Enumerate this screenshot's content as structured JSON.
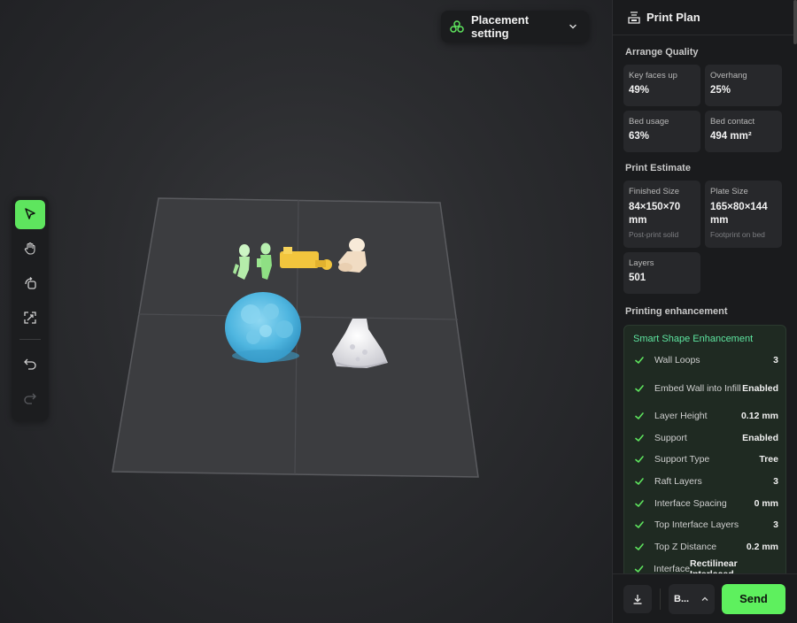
{
  "viewport": {
    "placement": {
      "label": "Placement setting",
      "icon": "placement-icon"
    },
    "toolbar": [
      {
        "name": "select-tool",
        "icon": "cursor-arrow-icon",
        "active": true
      },
      {
        "name": "pan-tool",
        "icon": "hand-icon",
        "active": false
      },
      {
        "name": "rotate-tool",
        "icon": "rotate-icon",
        "active": false
      },
      {
        "name": "scale-tool",
        "icon": "scale-arrows-icon",
        "active": false
      },
      {
        "name": "undo-button",
        "icon": "undo-icon",
        "active": false
      },
      {
        "name": "redo-button",
        "icon": "redo-icon",
        "active": false
      }
    ],
    "models": [
      "green-figure-1",
      "green-figure-2",
      "yellow-part",
      "beige-figure",
      "blue-round-model",
      "white-dress-model"
    ]
  },
  "panel": {
    "title": "Print Plan",
    "title_icon": "print-plan-icon",
    "arrange_quality": {
      "title": "Arrange Quality",
      "stats": [
        {
          "key": "Key faces up",
          "value": "49%"
        },
        {
          "key": "Overhang",
          "value": "25%"
        },
        {
          "key": "Bed usage",
          "value": "63%"
        },
        {
          "key": "Bed contact",
          "value": "494 mm²"
        }
      ]
    },
    "print_estimate": {
      "title": "Print Estimate",
      "finished": {
        "key": "Finished Size",
        "value": "84×150×70 mm",
        "sub": "Post-print solid"
      },
      "plate": {
        "key": "Plate Size",
        "value": "165×80×144 mm",
        "sub": "Footprint on bed"
      },
      "layers": {
        "key": "Layers",
        "value": "501"
      }
    },
    "enhancement": {
      "title": "Printing enhancement",
      "box_title": "Smart Shape Enhancement",
      "items": [
        {
          "name": "Wall Loops",
          "value": "3"
        },
        {
          "name": "Embed Wall into Infill",
          "value": "Enabled"
        },
        {
          "name": "Layer Height",
          "value": "0.12 mm"
        },
        {
          "name": "Support",
          "value": "Enabled"
        },
        {
          "name": "Support Type",
          "value": "Tree"
        },
        {
          "name": "Raft Layers",
          "value": "3"
        },
        {
          "name": "Interface Spacing",
          "value": "0 mm"
        },
        {
          "name": "Top Interface Layers",
          "value": "3"
        },
        {
          "name": "Top Z Distance",
          "value": "0.2 mm"
        },
        {
          "name": "Interface",
          "value": "Rectilinear Interlaced"
        }
      ]
    },
    "footer": {
      "download_icon": "download-icon",
      "printer": "B...",
      "send": "Send"
    }
  },
  "colors": {
    "accent": "#5EF05E",
    "model_green": "#B8F0B0",
    "model_yellow": "#F2C53D",
    "model_beige": "#F4E2CC",
    "model_blue": "#5FC3E8",
    "model_white": "#E8E8EC"
  }
}
